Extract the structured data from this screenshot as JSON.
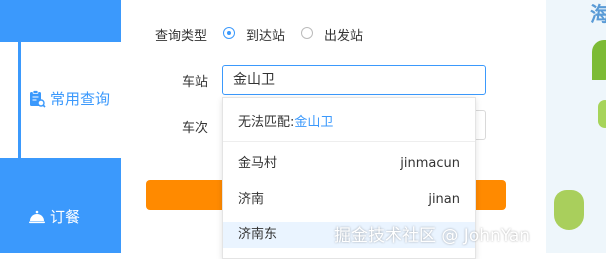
{
  "sidebar": {
    "items": [
      {
        "label": "常用查询",
        "icon": "clipboard-search-icon",
        "active": true
      },
      {
        "label": "订餐",
        "icon": "food-cloche-icon",
        "active": false
      }
    ]
  },
  "form": {
    "query_type_label": "查询类型",
    "query_type_options": [
      {
        "label": "到达站",
        "selected": true
      },
      {
        "label": "出发站",
        "selected": false
      }
    ],
    "station_label": "车站",
    "station_value": "金山卫",
    "train_label": "车次",
    "train_value": ""
  },
  "dropdown": {
    "no_match_prefix": "无法匹配:",
    "no_match_value": "金山卫",
    "items": [
      {
        "name": "金马村",
        "pinyin": "jinmacun"
      },
      {
        "name": "济南",
        "pinyin": "jinan"
      },
      {
        "name": "济南东",
        "pinyin": ""
      }
    ]
  },
  "right_panel": {
    "brand_char": "海"
  },
  "watermark": "掘金技术社区 @ JohnYan",
  "colors": {
    "accent": "#3b99fc",
    "button": "#ff8a00"
  }
}
